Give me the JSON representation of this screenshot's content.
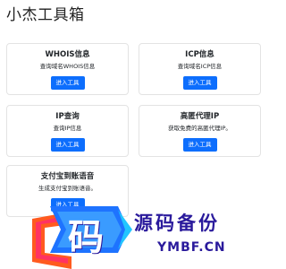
{
  "page": {
    "title": "小杰工具箱"
  },
  "tools": [
    {
      "name": "WHOIS信息",
      "desc": "查询域名WHOIS信息",
      "button": "进入工具"
    },
    {
      "name": "ICP信息",
      "desc": "查询域名ICP信息",
      "button": "进入工具"
    },
    {
      "name": "IP查询",
      "desc": "查询IP信息",
      "button": "进入工具"
    },
    {
      "name": "高匿代理IP",
      "desc": "获取免费的高匿代理IP。",
      "button": "进入工具"
    },
    {
      "name": "支付宝到账语音",
      "desc": "生成支付宝到账语音。",
      "button": "进入工具"
    }
  ],
  "watermark": {
    "logo_char": "码",
    "cn": "源码备份",
    "en": "YMBF.CN"
  },
  "colors": {
    "button": "#0d6efd",
    "watermark_text": "#2a1a9c",
    "card_border": "#e3e3e3"
  }
}
